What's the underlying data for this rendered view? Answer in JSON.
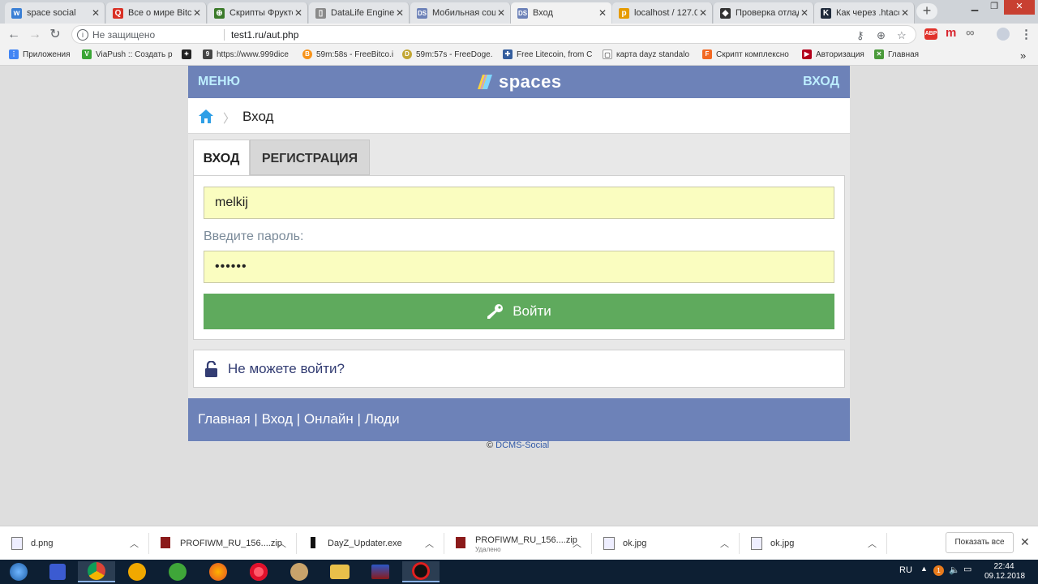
{
  "browser": {
    "tabs": [
      {
        "title": "space social",
        "fav_color": "#3a7fd5",
        "fav_glyph": "w",
        "active": false
      },
      {
        "title": "Все о мире Bitco",
        "fav_color": "#d93025",
        "fav_glyph": "Q",
        "active": false
      },
      {
        "title": "Скрипты Фрукто",
        "fav_color": "#3b7a2a",
        "fav_glyph": "⊕",
        "active": false
      },
      {
        "title": "DataLife Engine",
        "fav_color": "#8a8a8a",
        "fav_glyph": "▯",
        "active": false
      },
      {
        "title": "Мобильная соц",
        "fav_color": "#6d82b8",
        "fav_glyph": "DS",
        "active": false
      },
      {
        "title": "Вход",
        "fav_color": "#6d82b8",
        "fav_glyph": "DS",
        "active": true
      },
      {
        "title": "localhost / 127.0",
        "fav_color": "#e69b00",
        "fav_glyph": "p",
        "active": false
      },
      {
        "title": "Проверка отлад",
        "fav_color": "#333333",
        "fav_glyph": "◆",
        "active": false
      },
      {
        "title": "Как через .htacc",
        "fav_color": "#1f2a3a",
        "fav_glyph": "K",
        "active": false
      }
    ],
    "address": {
      "security": "Не защищено",
      "url": "test1.ru/aut.php"
    },
    "bookmarks": [
      {
        "label": "Приложения",
        "fav_color": "#4285f4",
        "fav_glyph": "⋮"
      },
      {
        "label": "ViaPush :: Создать р",
        "fav_color": "#3aa635",
        "fav_glyph": "V"
      },
      {
        "label": "",
        "fav_color": "#222222",
        "fav_glyph": "✦"
      },
      {
        "label": "https://www.999dice",
        "fav_color": "#444444",
        "fav_glyph": "9"
      },
      {
        "label": "59m:58s - FreeBitco.i",
        "fav_color": "#f7931a",
        "fav_glyph": "B"
      },
      {
        "label": "59m:57s - FreeDoge.",
        "fav_color": "#c2a633",
        "fav_glyph": "D"
      },
      {
        "label": "Free Litecoin, from C",
        "fav_color": "#345d9d",
        "fav_glyph": "✚"
      },
      {
        "label": "карта dayz standalo",
        "fav_color": "#ffffff",
        "fav_glyph": "▢"
      },
      {
        "label": "Скрипт комплексно",
        "fav_color": "#f26822",
        "fav_glyph": "F"
      },
      {
        "label": "Авторизация",
        "fav_color": "#b3001b",
        "fav_glyph": "▶"
      },
      {
        "label": "Главная",
        "fav_color": "#4a9a3a",
        "fav_glyph": "✕"
      }
    ]
  },
  "site": {
    "menu_label": "МЕНЮ",
    "logo_text": "spaces",
    "login_label": "ВХОД",
    "breadcrumb_label": "Вход",
    "tabs": {
      "login": "ВХОД",
      "register": "РЕГИСТРАЦИЯ"
    },
    "form": {
      "username_value": "melkij",
      "password_label": "Введите пароль:",
      "password_value": "••••••",
      "submit_label": "Войти"
    },
    "forgot_label": "Не можете войти?",
    "footer_links": "Главная | Вход | Онлайн | Люди",
    "copyright_symbol": "©",
    "copyright_link": "DCMS-Social",
    "colors": {
      "header": "#6d82b8",
      "header_link": "#bdeeff",
      "submit": "#5faa5d",
      "field_bg": "#fafdc0"
    }
  },
  "downloads": {
    "items": [
      {
        "name": "d.png",
        "sub": ""
      },
      {
        "name": "PROFIWM_RU_156....zip",
        "sub": ""
      },
      {
        "name": "DayZ_Updater.exe",
        "sub": ""
      },
      {
        "name": "PROFIWM_RU_156....zip",
        "sub": "Удалено"
      },
      {
        "name": "ok.jpg",
        "sub": ""
      },
      {
        "name": "ok.jpg",
        "sub": ""
      }
    ],
    "show_all": "Показать все"
  },
  "taskbar": {
    "lang": "RU",
    "time": "22:44",
    "date": "09.12.2018"
  }
}
